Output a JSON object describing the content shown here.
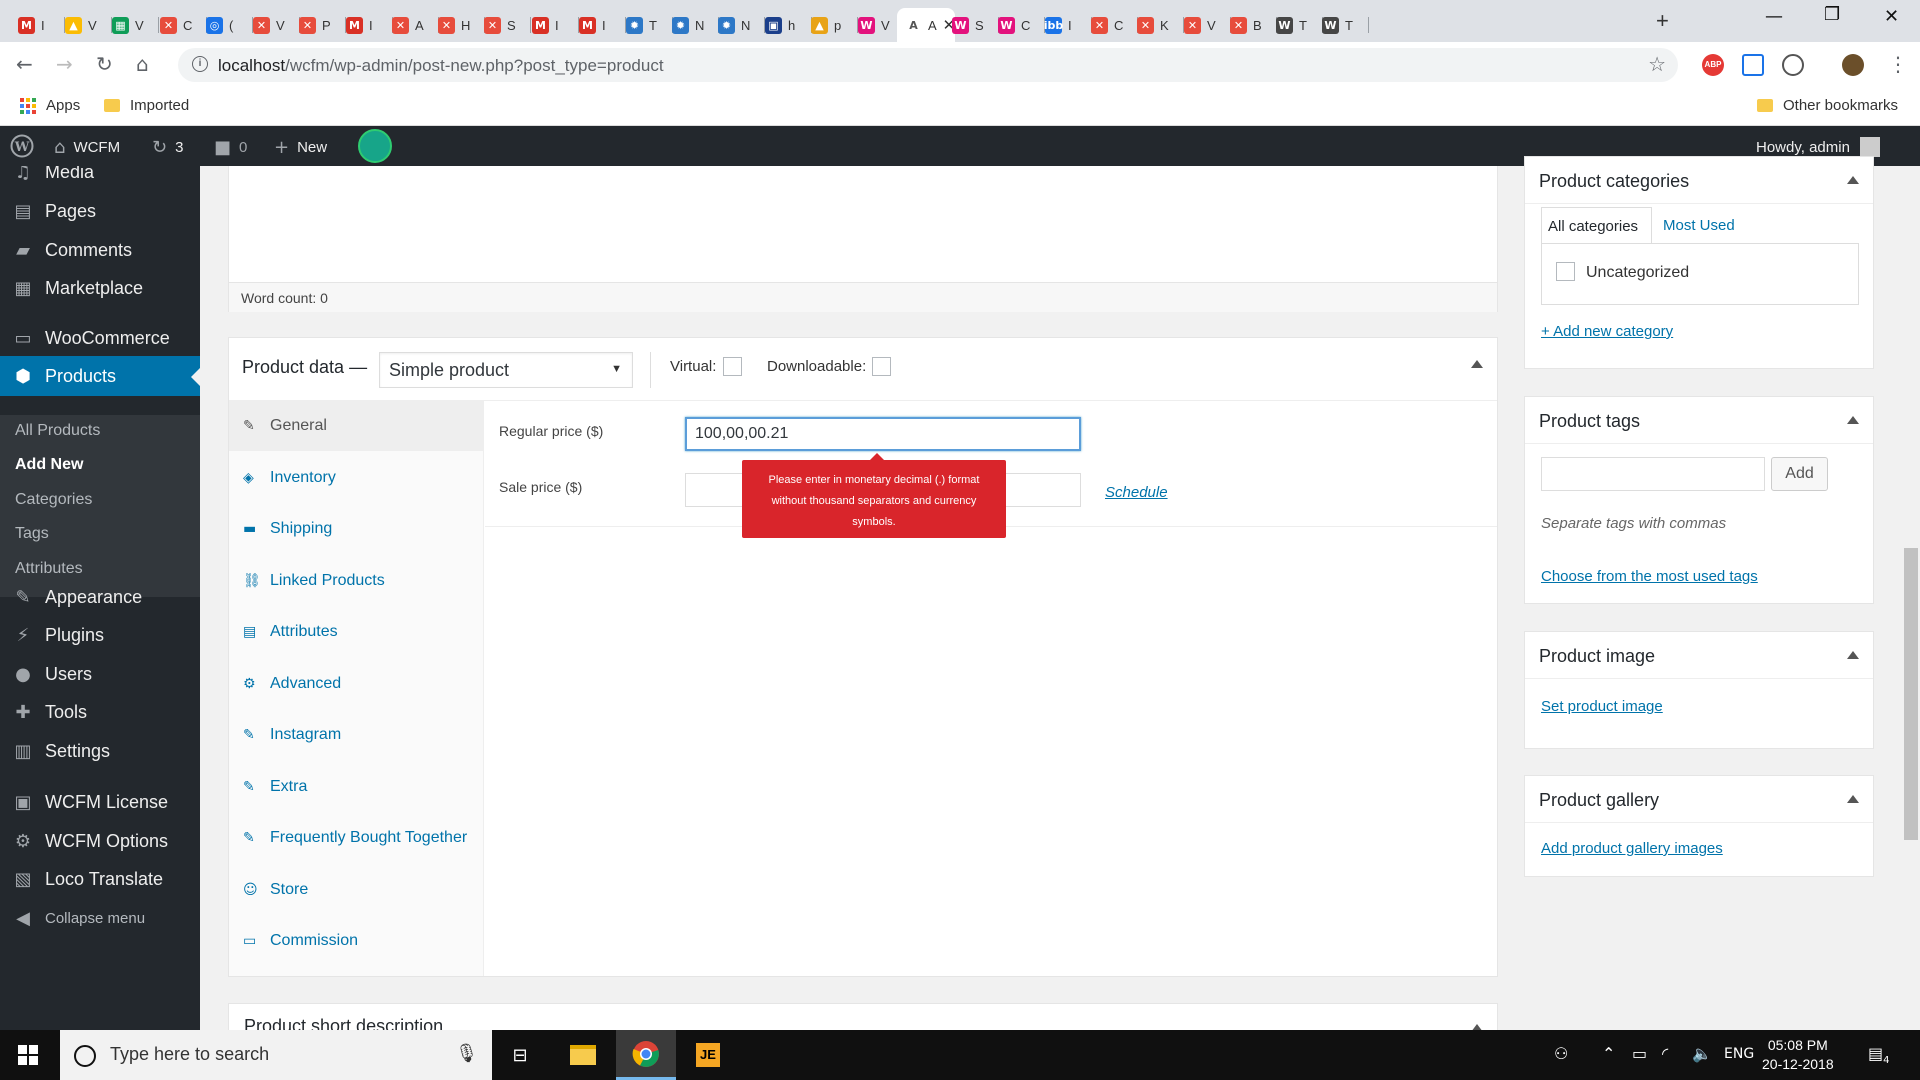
{
  "browser": {
    "tabs": [
      {
        "icon": "gmail-icon",
        "label": "M",
        "title": "I",
        "color": "#d93025"
      },
      {
        "icon": "drive-icon",
        "label": "▲",
        "title": "V",
        "color": "#fbbc04"
      },
      {
        "icon": "sheets-icon",
        "label": "▦",
        "title": "V",
        "color": "#0f9d58"
      },
      {
        "icon": "wcfm-icon",
        "label": "✕",
        "title": "C",
        "color": "#e74c3c"
      },
      {
        "icon": "shield-icon",
        "label": "◎",
        "title": "(",
        "color": "#1a73e8"
      },
      {
        "icon": "wcfm-icon",
        "label": "✕",
        "title": "V",
        "color": "#e74c3c"
      },
      {
        "icon": "wcfm-icon",
        "label": "✕",
        "title": "P",
        "color": "#e74c3c"
      },
      {
        "icon": "gmail-icon",
        "label": "M",
        "title": "I",
        "color": "#d93025"
      },
      {
        "icon": "wcfm-icon",
        "label": "✕",
        "title": "A",
        "color": "#e74c3c"
      },
      {
        "icon": "wcfm-icon",
        "label": "✕",
        "title": "H",
        "color": "#e74c3c"
      },
      {
        "icon": "wcfm-icon",
        "label": "✕",
        "title": "S",
        "color": "#e74c3c"
      },
      {
        "icon": "gmail-icon",
        "label": "M",
        "title": "I",
        "color": "#d93025"
      },
      {
        "icon": "gmail-icon",
        "label": "M",
        "title": "I",
        "color": "#d93025"
      },
      {
        "icon": "gear-icon",
        "label": "✹",
        "title": "T",
        "color": "#2d78c7"
      },
      {
        "icon": "gear-icon",
        "label": "✹",
        "title": "N",
        "color": "#2d78c7"
      },
      {
        "icon": "gear-icon",
        "label": "✹",
        "title": "N",
        "color": "#2d78c7"
      },
      {
        "icon": "calendar-icon",
        "label": "▣",
        "title": "h",
        "color": "#1b3f8b"
      },
      {
        "icon": "pha-icon",
        "label": "▲",
        "title": "p",
        "color": "#e8a317"
      },
      {
        "icon": "wcfm-circle-icon",
        "label": "W",
        "title": "V",
        "color": "#e3127d"
      },
      {
        "icon": "active-tab-icon",
        "label": "A",
        "title": "A",
        "color": "#ffffff"
      },
      {
        "icon": "wcfm-circle-icon",
        "label": "W",
        "title": "S",
        "color": "#e3127d"
      },
      {
        "icon": "wcfm-circle-icon",
        "label": "W",
        "title": "C",
        "color": "#e3127d"
      },
      {
        "icon": "ibb-icon",
        "label": "ibb",
        "title": "I",
        "color": "#1a73e8"
      },
      {
        "icon": "wcfm-icon",
        "label": "✕",
        "title": "C",
        "color": "#e74c3c"
      },
      {
        "icon": "wcfm-icon",
        "label": "✕",
        "title": "K",
        "color": "#e74c3c"
      },
      {
        "icon": "wcfm-icon",
        "label": "✕",
        "title": "V",
        "color": "#e74c3c"
      },
      {
        "icon": "wcfm-icon",
        "label": "✕",
        "title": "B",
        "color": "#e74c3c"
      },
      {
        "icon": "wordpress-icon",
        "label": "W",
        "title": "T",
        "color": "#464646"
      },
      {
        "icon": "wordpress-icon",
        "label": "W",
        "title": "T",
        "color": "#464646"
      }
    ],
    "url_host": "localhost",
    "url_path": "/wcfm/wp-admin/post-new.php?post_type=product",
    "bookmarks": {
      "apps": "Apps",
      "imported": "Imported",
      "other": "Other bookmarks"
    }
  },
  "adminbar": {
    "site": "WCFM",
    "updates": "3",
    "comments": "0",
    "new": "New",
    "howdy": "Howdy, admin"
  },
  "sidebar": {
    "items": [
      {
        "label": "Media",
        "icon": "media-icon"
      },
      {
        "label": "Pages",
        "icon": "pages-icon"
      },
      {
        "label": "Comments",
        "icon": "comments-icon"
      },
      {
        "label": "Marketplace",
        "icon": "marketplace-icon"
      },
      {
        "label": "WooCommerce",
        "icon": "woocommerce-icon"
      },
      {
        "label": "Products",
        "icon": "products-icon"
      },
      {
        "label": "Appearance",
        "icon": "appearance-icon"
      },
      {
        "label": "Plugins",
        "icon": "plugins-icon"
      },
      {
        "label": "Users",
        "icon": "users-icon"
      },
      {
        "label": "Tools",
        "icon": "tools-icon"
      },
      {
        "label": "Settings",
        "icon": "settings-icon"
      },
      {
        "label": "WCFM License",
        "icon": "license-icon"
      },
      {
        "label": "WCFM Options",
        "icon": "options-icon"
      },
      {
        "label": "Loco Translate",
        "icon": "translate-icon"
      },
      {
        "label": "Collapse menu",
        "icon": "collapse-icon"
      }
    ],
    "submenu": [
      "All Products",
      "Add New",
      "Categories",
      "Tags",
      "Attributes"
    ]
  },
  "editor": {
    "word_count": "Word count: 0"
  },
  "product_data": {
    "title": "Product data —",
    "type": "Simple product",
    "virtual": "Virtual:",
    "downloadable": "Downloadable:",
    "tabs": [
      "General",
      "Inventory",
      "Shipping",
      "Linked Products",
      "Attributes",
      "Advanced",
      "Instagram",
      "Extra",
      "Frequently Bought Together",
      "Store",
      "Commission"
    ],
    "regular_price_label": "Regular price ($)",
    "regular_price_value": "100,00,00.21",
    "sale_price_label": "Sale price ($)",
    "sale_price_value": "",
    "schedule": "Schedule",
    "tooltip": "Please enter in monetary decimal (.) format without thousand separators and currency symbols."
  },
  "short_description": "Product short description",
  "right": {
    "categories": {
      "title": "Product categories",
      "tab_all": "All categories",
      "tab_used": "Most Used",
      "item": "Uncategorized",
      "add": "+ Add new category"
    },
    "tags": {
      "title": "Product tags",
      "add": "Add",
      "hint": "Separate tags with commas",
      "choose": "Choose from the most used tags",
      "input": ""
    },
    "image": {
      "title": "Product image",
      "link": "Set product image"
    },
    "gallery": {
      "title": "Product gallery",
      "link": "Add product gallery images"
    }
  },
  "taskbar": {
    "search": "Type here to search",
    "lang": "ENG",
    "time": "05:08 PM",
    "date": "20-12-2018",
    "notifications": "4"
  }
}
